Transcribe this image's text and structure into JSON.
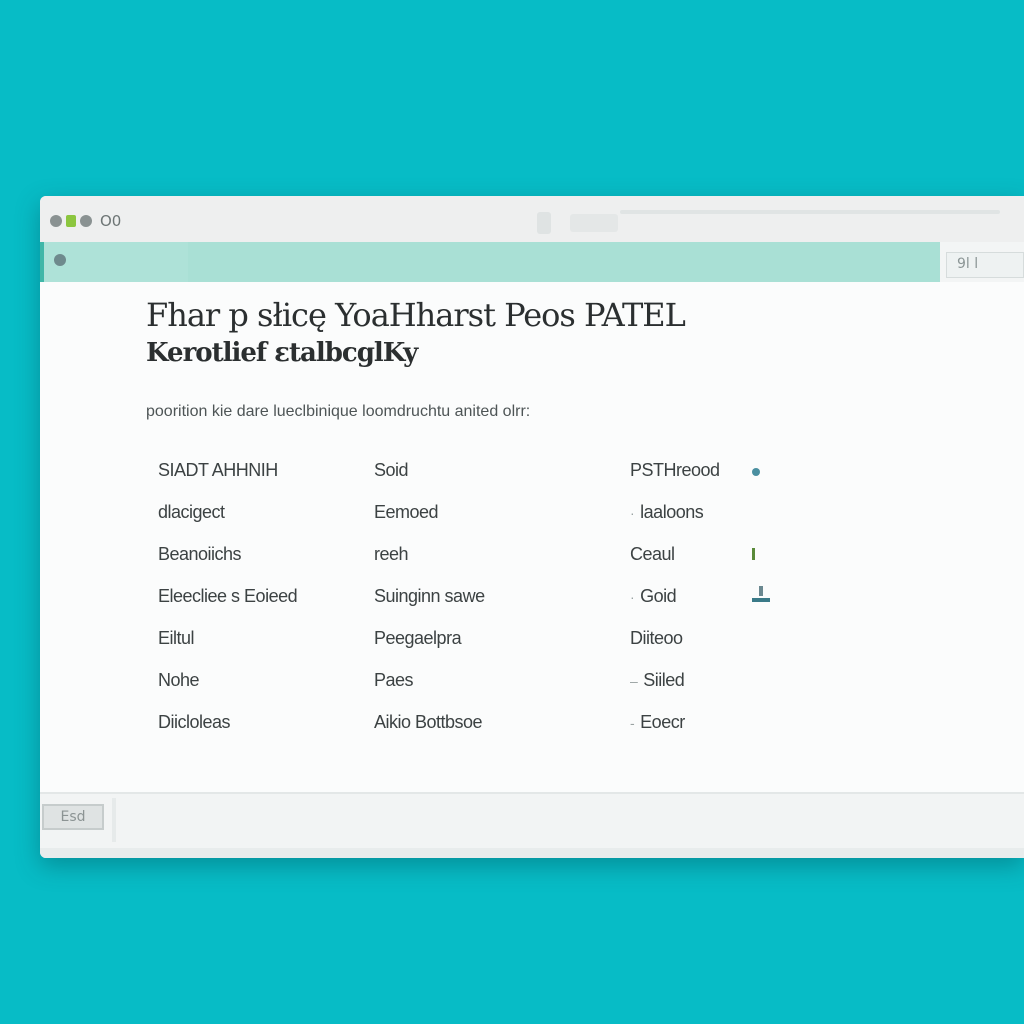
{
  "titlebar": {
    "text": "O0"
  },
  "tabbar": {
    "right_label": "9l l"
  },
  "content": {
    "heading": "Fhar p słicę YoaHharst Peos PATEL",
    "subheading": "Kerotlief ɛtalbcglKy",
    "description": "poorition kie dare lueclbinique loomdruchtu anited olrr:"
  },
  "table": {
    "rows": [
      {
        "c1": "SIADT AHHNIH",
        "c2": "Soid",
        "c3": "PSTHreood",
        "icon": "pin-icon",
        "marker": ""
      },
      {
        "c1": "dlacigect",
        "c2": "Eemoed",
        "c3": "laaloons",
        "icon": "",
        "marker": "·"
      },
      {
        "c1": "Beanoiichs",
        "c2": "reeh",
        "c3": "Ceaul",
        "icon": "bar-icon",
        "marker": ""
      },
      {
        "c1": "Eleecliee s Eoieed",
        "c2": "Suinginn sawe",
        "c3": "Goid",
        "icon": "tray-icon",
        "marker": "·"
      },
      {
        "c1": "Eiltul",
        "c2": "Peegaelpra",
        "c3": "Diiteoo",
        "icon": "",
        "marker": ""
      },
      {
        "c1": "Nohe",
        "c2": "Paes",
        "c3": "Siiled",
        "icon": "",
        "marker": "–"
      },
      {
        "c1": "Diicloleas",
        "c2": "Aikio Bottbsoe",
        "c3": "Eoecr",
        "icon": "",
        "marker": "-"
      }
    ]
  },
  "footer": {
    "button_label": "Esd"
  },
  "colors": {
    "background": "#07bcc6",
    "tab_accent": "#aee2d8"
  }
}
